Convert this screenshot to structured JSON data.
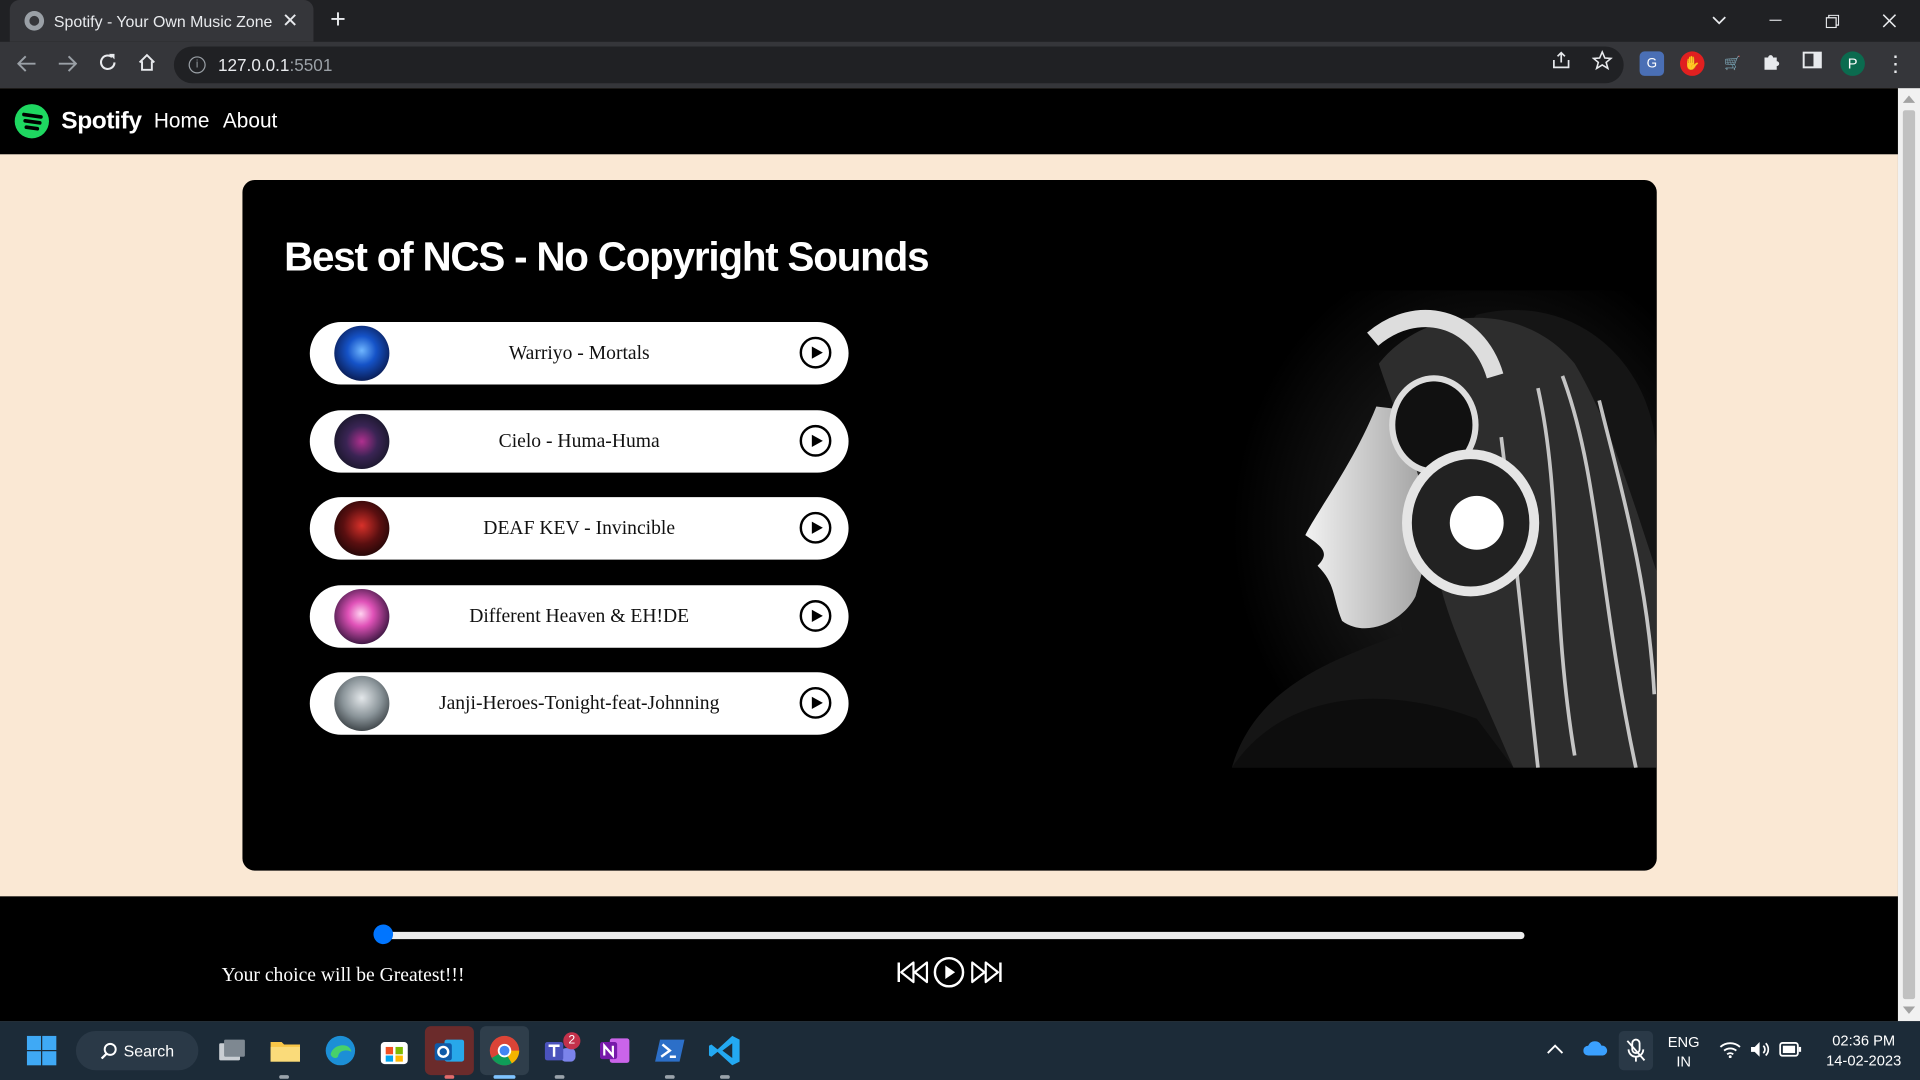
{
  "browser": {
    "tab_title": "Spotify - Your Own Music Zone",
    "tab_close": "✕",
    "new_tab": "+",
    "url_host": "127.0.0.1",
    "url_port": ":5501",
    "profile_initial": "P"
  },
  "nav": {
    "brand": "Spotify",
    "links": [
      "Home",
      "About"
    ]
  },
  "main": {
    "heading": "Best of NCS - No Copyright Sounds",
    "songs": [
      {
        "title": "Warriyo - Mortals"
      },
      {
        "title": "Cielo - Huma-Huma"
      },
      {
        "title": "DEAF KEV - Invincible"
      },
      {
        "title": "Different Heaven & EH!DE"
      },
      {
        "title": "Janji-Heroes-Tonight-feat-Johnning"
      }
    ]
  },
  "player": {
    "tagline": "Your choice will be Greatest!!!",
    "progress": 0
  },
  "taskbar": {
    "search_label": "Search",
    "teams_badge": "2",
    "lang_line1": "ENG",
    "lang_line2": "IN",
    "time": "02:36 PM",
    "date": "14-02-2023"
  },
  "colors": {
    "page_background": "#fae8d4",
    "spotify_green": "#1ed760",
    "slider_thumb": "#0075ff"
  }
}
